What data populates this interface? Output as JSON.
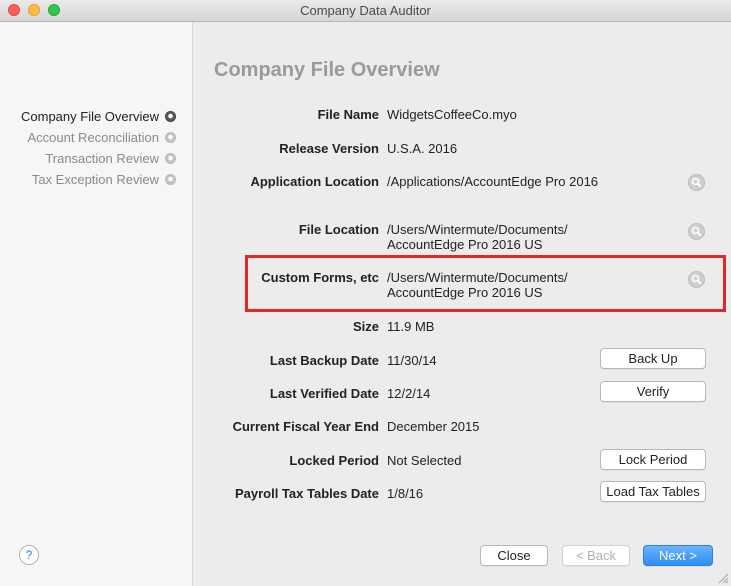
{
  "window": {
    "title": "Company Data Auditor"
  },
  "sidebar": {
    "steps": [
      {
        "label": "Company File Overview",
        "active": true
      },
      {
        "label": "Account Reconciliation",
        "active": false
      },
      {
        "label": "Transaction Review",
        "active": false
      },
      {
        "label": "Tax Exception Review",
        "active": false
      }
    ],
    "help_label": "?"
  },
  "main": {
    "heading": "Company File Overview",
    "fields": {
      "file_name": {
        "label": "File Name",
        "value": "WidgetsCoffeeCo.myo"
      },
      "release_version": {
        "label": "Release Version",
        "value": "U.S.A. 2016"
      },
      "application_location": {
        "label": "Application Location",
        "value": "/Applications/AccountEdge Pro 2016"
      },
      "file_location": {
        "label": "File Location",
        "value_line1": "/Users/Wintermute/Documents/",
        "value_line2": "AccountEdge Pro 2016 US"
      },
      "custom_forms": {
        "label": "Custom Forms, etc",
        "value_line1": "/Users/Wintermute/Documents/",
        "value_line2": "AccountEdge Pro 2016 US"
      },
      "size": {
        "label": "Size",
        "value": "11.9 MB"
      },
      "last_backup_date": {
        "label": "Last Backup Date",
        "value": "11/30/14"
      },
      "last_verified_date": {
        "label": "Last Verified Date",
        "value": "12/2/14"
      },
      "fiscal_year_end": {
        "label": "Current Fiscal Year End",
        "value": "December 2015"
      },
      "locked_period": {
        "label": "Locked Period",
        "value": "Not Selected"
      },
      "payroll_tax_tables_date": {
        "label": "Payroll Tax Tables Date",
        "value": "1/8/16"
      }
    },
    "buttons": {
      "back_up": "Back Up",
      "verify": "Verify",
      "lock_period": "Lock Period",
      "load_tax_tables": "Load Tax Tables"
    }
  },
  "footer": {
    "close": "Close",
    "back": "< Back",
    "next": "Next >"
  },
  "colors": {
    "highlight": "#e0282a",
    "primary_button": "#2c8ef4"
  }
}
